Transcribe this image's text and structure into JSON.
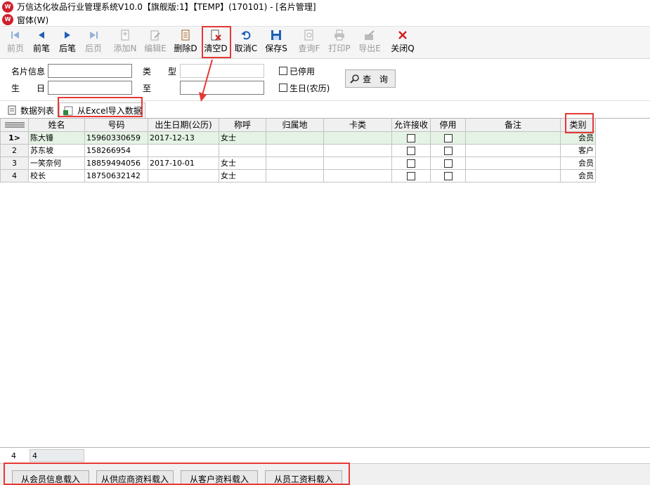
{
  "window": {
    "title": "万信达化妆品行业管理系统V10.0【旗舰版:1】【TEMP】(170101) - [名片管理]"
  },
  "menu": {
    "items": [
      {
        "label": "窗体(W)"
      }
    ]
  },
  "toolbar": {
    "buttons": [
      {
        "label": "前页",
        "icon": "first-page-icon",
        "enabled": false
      },
      {
        "label": "前笔",
        "icon": "previous-record-icon",
        "enabled": true
      },
      {
        "label": "后笔",
        "icon": "next-record-icon",
        "enabled": true
      },
      {
        "label": "后页",
        "icon": "last-page-icon",
        "enabled": false
      },
      {
        "label": "添加N",
        "icon": "add-icon",
        "enabled": false
      },
      {
        "label": "编辑E",
        "icon": "edit-icon",
        "enabled": false
      },
      {
        "label": "删除D",
        "icon": "delete-icon",
        "enabled": true
      },
      {
        "label": "清空D",
        "icon": "clear-icon",
        "enabled": true
      },
      {
        "label": "取消C",
        "icon": "undo-icon",
        "enabled": true
      },
      {
        "label": "保存S",
        "icon": "save-icon",
        "enabled": true
      },
      {
        "label": "查询F",
        "icon": "query-icon",
        "enabled": false
      },
      {
        "label": "打印P",
        "icon": "print-icon",
        "enabled": false
      },
      {
        "label": "导出E",
        "icon": "export-icon",
        "enabled": false
      },
      {
        "label": "关闭Q",
        "icon": "close-icon",
        "enabled": true
      }
    ]
  },
  "filter": {
    "card_info_label": "名片信息",
    "type_label": "类　　型",
    "birthday_label": "生　　日",
    "to_label": "至",
    "disabled_label": "已停用",
    "lunar_birthday_label": "生日(农历)",
    "query_button": "查 询",
    "card_info_value": "",
    "type_value": "",
    "birthday_from": "",
    "birthday_to": ""
  },
  "tabs": [
    {
      "label": "数据列表",
      "icon": "document-icon"
    },
    {
      "label": "从Excel导入数据",
      "icon": "excel-icon",
      "active": true
    }
  ],
  "grid": {
    "columns": [
      "姓名",
      "号码",
      "出生日期(公历)",
      "称呼",
      "归属地",
      "卡类",
      "允许接收",
      "停用",
      "备注",
      "类别"
    ],
    "rows": [
      {
        "num": "1",
        "marker": ">",
        "name": "陈大锤",
        "phone": "15960330659",
        "birth": "2017-12-13",
        "title": "女士",
        "region": "",
        "card": "",
        "allow": false,
        "disabled": false,
        "note": "",
        "category": "会员"
      },
      {
        "num": "2",
        "marker": "",
        "name": "苏东坡",
        "phone": "158266954",
        "birth": "",
        "title": "",
        "region": "",
        "card": "",
        "allow": false,
        "disabled": false,
        "note": "",
        "category": "客户"
      },
      {
        "num": "3",
        "marker": "",
        "name": "一笑奈何",
        "phone": "18859494056",
        "birth": "2017-10-01",
        "title": "女士",
        "region": "",
        "card": "",
        "allow": false,
        "disabled": false,
        "note": "",
        "category": "会员"
      },
      {
        "num": "4",
        "marker": "",
        "name": "校长",
        "phone": "18750632142",
        "birth": "",
        "title": "女士",
        "region": "",
        "card": "",
        "allow": false,
        "disabled": false,
        "note": "",
        "category": "会员"
      }
    ],
    "footer_count": "4",
    "footer_value": "4"
  },
  "bottom": {
    "buttons": [
      {
        "label": "从会员信息载入"
      },
      {
        "label": "从供应商资料载入"
      },
      {
        "label": "从客户资料载入"
      },
      {
        "label": "从员工资料载入"
      }
    ]
  },
  "colors": {
    "highlight": "#e53935",
    "selected_row": "#e4f3e4",
    "toolbar_bg": "#f5f5f5"
  }
}
